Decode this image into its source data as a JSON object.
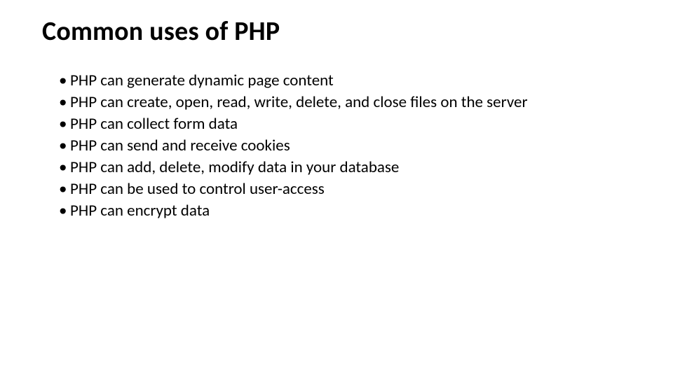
{
  "title": "Common uses of PHP",
  "bullets": [
    "PHP can generate dynamic page content",
    "PHP can create, open, read, write, delete, and close files on the server",
    "PHP can collect form data",
    "PHP can send and receive cookies",
    "PHP can add, delete, modify data in your database",
    "PHP can be used to control user-access",
    "PHP can encrypt data"
  ]
}
